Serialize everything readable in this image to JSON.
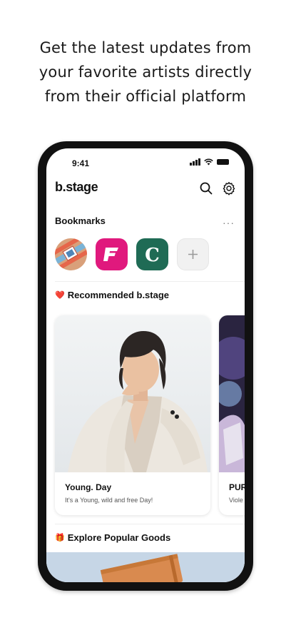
{
  "headline": {
    "line1": "Get the latest updates from",
    "line2": "your favorite artists directly",
    "line3": "from their official platform"
  },
  "status_bar": {
    "time": "9:41"
  },
  "app": {
    "logo": "b.stage",
    "search_icon": "search-icon",
    "settings_icon": "gear-icon"
  },
  "bookmarks": {
    "title": "Bookmarks",
    "more": "···",
    "items": [
      {
        "icon": "artwork-thumbnail"
      },
      {
        "icon": "f-logo",
        "letter": "F",
        "color": "#e0197d"
      },
      {
        "icon": "c-logo",
        "letter": "C",
        "color": "#1f6b55"
      },
      {
        "icon": "plus-icon",
        "label": "+"
      }
    ]
  },
  "recommended": {
    "title": "Recommended b.stage",
    "emoji": "❤️",
    "cards": [
      {
        "title": "Young. Day",
        "subtitle": "It's a Young, wild and free Day!"
      },
      {
        "title": "PUR",
        "subtitle": "Viole"
      }
    ]
  },
  "goods": {
    "title": "Explore Popular Goods",
    "emoji": "🎁"
  }
}
